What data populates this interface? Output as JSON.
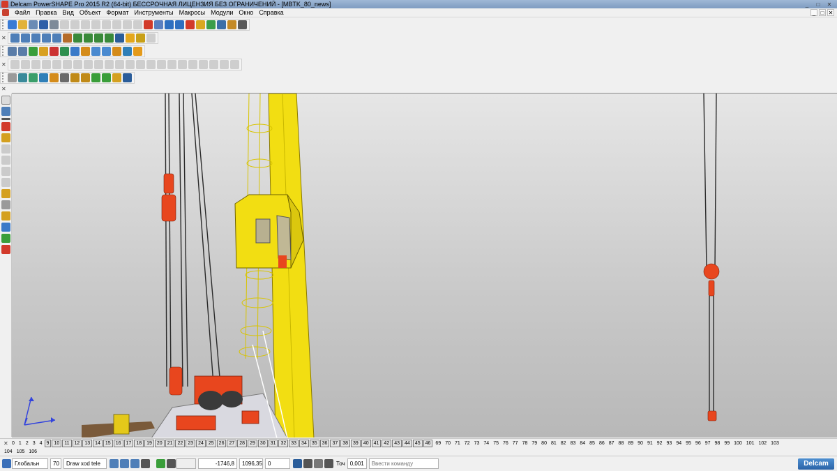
{
  "window": {
    "title": "Delcam PowerSHAPE Pro 2015 R2 (64-bit) БЕССРОЧНАЯ ЛИЦЕНЗИЯ БЕЗ ОГРАНИЧЕНИЙ - [MBTK_80_news]",
    "controls": [
      "_",
      "□",
      "✕"
    ]
  },
  "menu": {
    "items": [
      "Файл",
      "Правка",
      "Вид",
      "Объект",
      "Формат",
      "Инструменты",
      "Макросы",
      "Модули",
      "Окно",
      "Справка"
    ],
    "mdi_controls": [
      "_",
      "□",
      "✕"
    ]
  },
  "colors": {
    "accent": "#2b63a7",
    "crane_yellow": "#f2de12",
    "machine_red": "#e8461e",
    "cable": "#2a2a2a"
  },
  "levels": {
    "row1": [
      "0",
      "1",
      "2",
      "3",
      "4",
      "9",
      "10",
      "11",
      "12",
      "13",
      "14",
      "15",
      "16",
      "17",
      "18",
      "19",
      "20",
      "21",
      "22",
      "23",
      "24",
      "25",
      "26",
      "27",
      "28",
      "29",
      "30",
      "31",
      "32",
      "33",
      "34",
      "35",
      "36",
      "37",
      "38",
      "39",
      "40",
      "41",
      "42",
      "43",
      "44",
      "45",
      "46",
      "69",
      "70",
      "71",
      "72",
      "73",
      "74",
      "75",
      "76",
      "77",
      "78",
      "79",
      "80",
      "81",
      "82",
      "83",
      "84",
      "85",
      "86",
      "87",
      "88",
      "89",
      "90",
      "91",
      "92",
      "93",
      "94",
      "95",
      "96",
      "97",
      "98",
      "99",
      "100",
      "101",
      "102",
      "103"
    ],
    "boxed_from": "9",
    "boxed_to": "46",
    "row2": [
      "104",
      "105",
      "106"
    ]
  },
  "status": {
    "workplane": "Глобальн",
    "level_number": "70",
    "level_name": "Draw xod tele",
    "coord_x": "-1746,8",
    "coord_y": "1096,35",
    "coord_z": "0",
    "tolerance_label": "Точ",
    "tolerance_value": "0,001",
    "command_placeholder": "Ввести команду",
    "brand": "Delcam"
  }
}
